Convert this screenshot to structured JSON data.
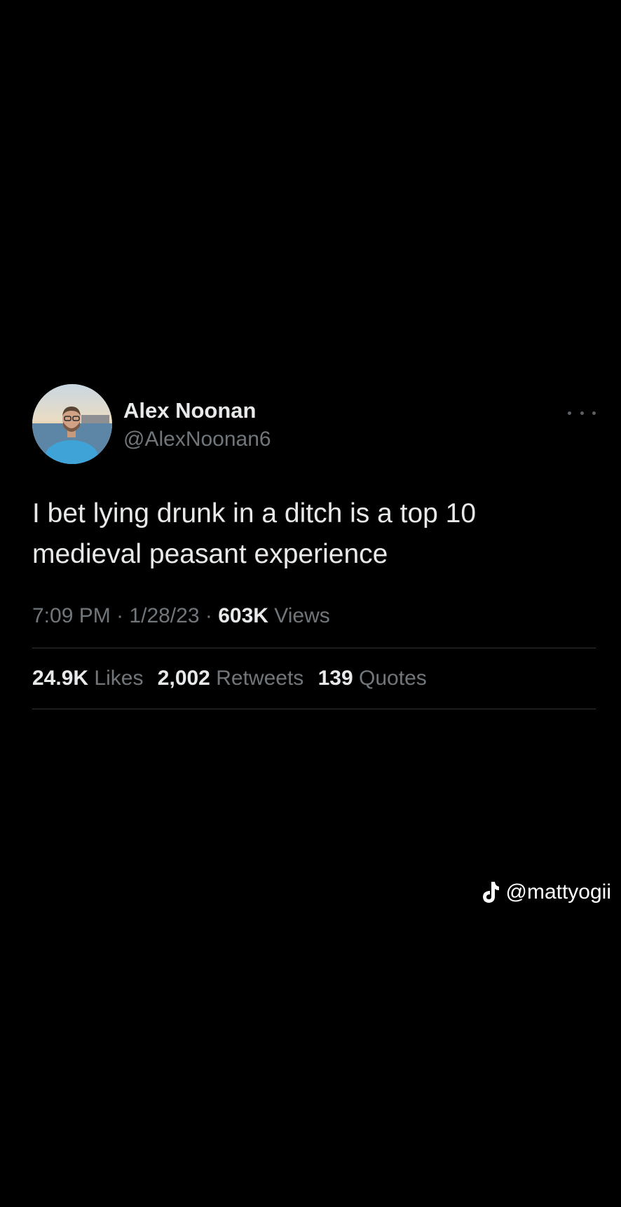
{
  "tweet": {
    "author_name": "Alex Noonan",
    "author_handle": "@AlexNoonan6",
    "text": "I bet lying drunk in a ditch is a top 10 medieval peasant experience",
    "time": "7:09 PM",
    "separator": "·",
    "date": "1/28/23",
    "views_count": "603K",
    "views_label": "Views",
    "likes_count": "24.9K",
    "likes_label": "Likes",
    "retweets_count": "2,002",
    "retweets_label": "Retweets",
    "quotes_count": "139",
    "quotes_label": "Quotes"
  },
  "watermark": {
    "icon": "tiktok-icon",
    "handle": "@mattyogii"
  },
  "colors": {
    "background": "#000000",
    "primary_text": "#e7e9ea",
    "secondary_text": "#71767b",
    "divider": "#2f3336"
  }
}
